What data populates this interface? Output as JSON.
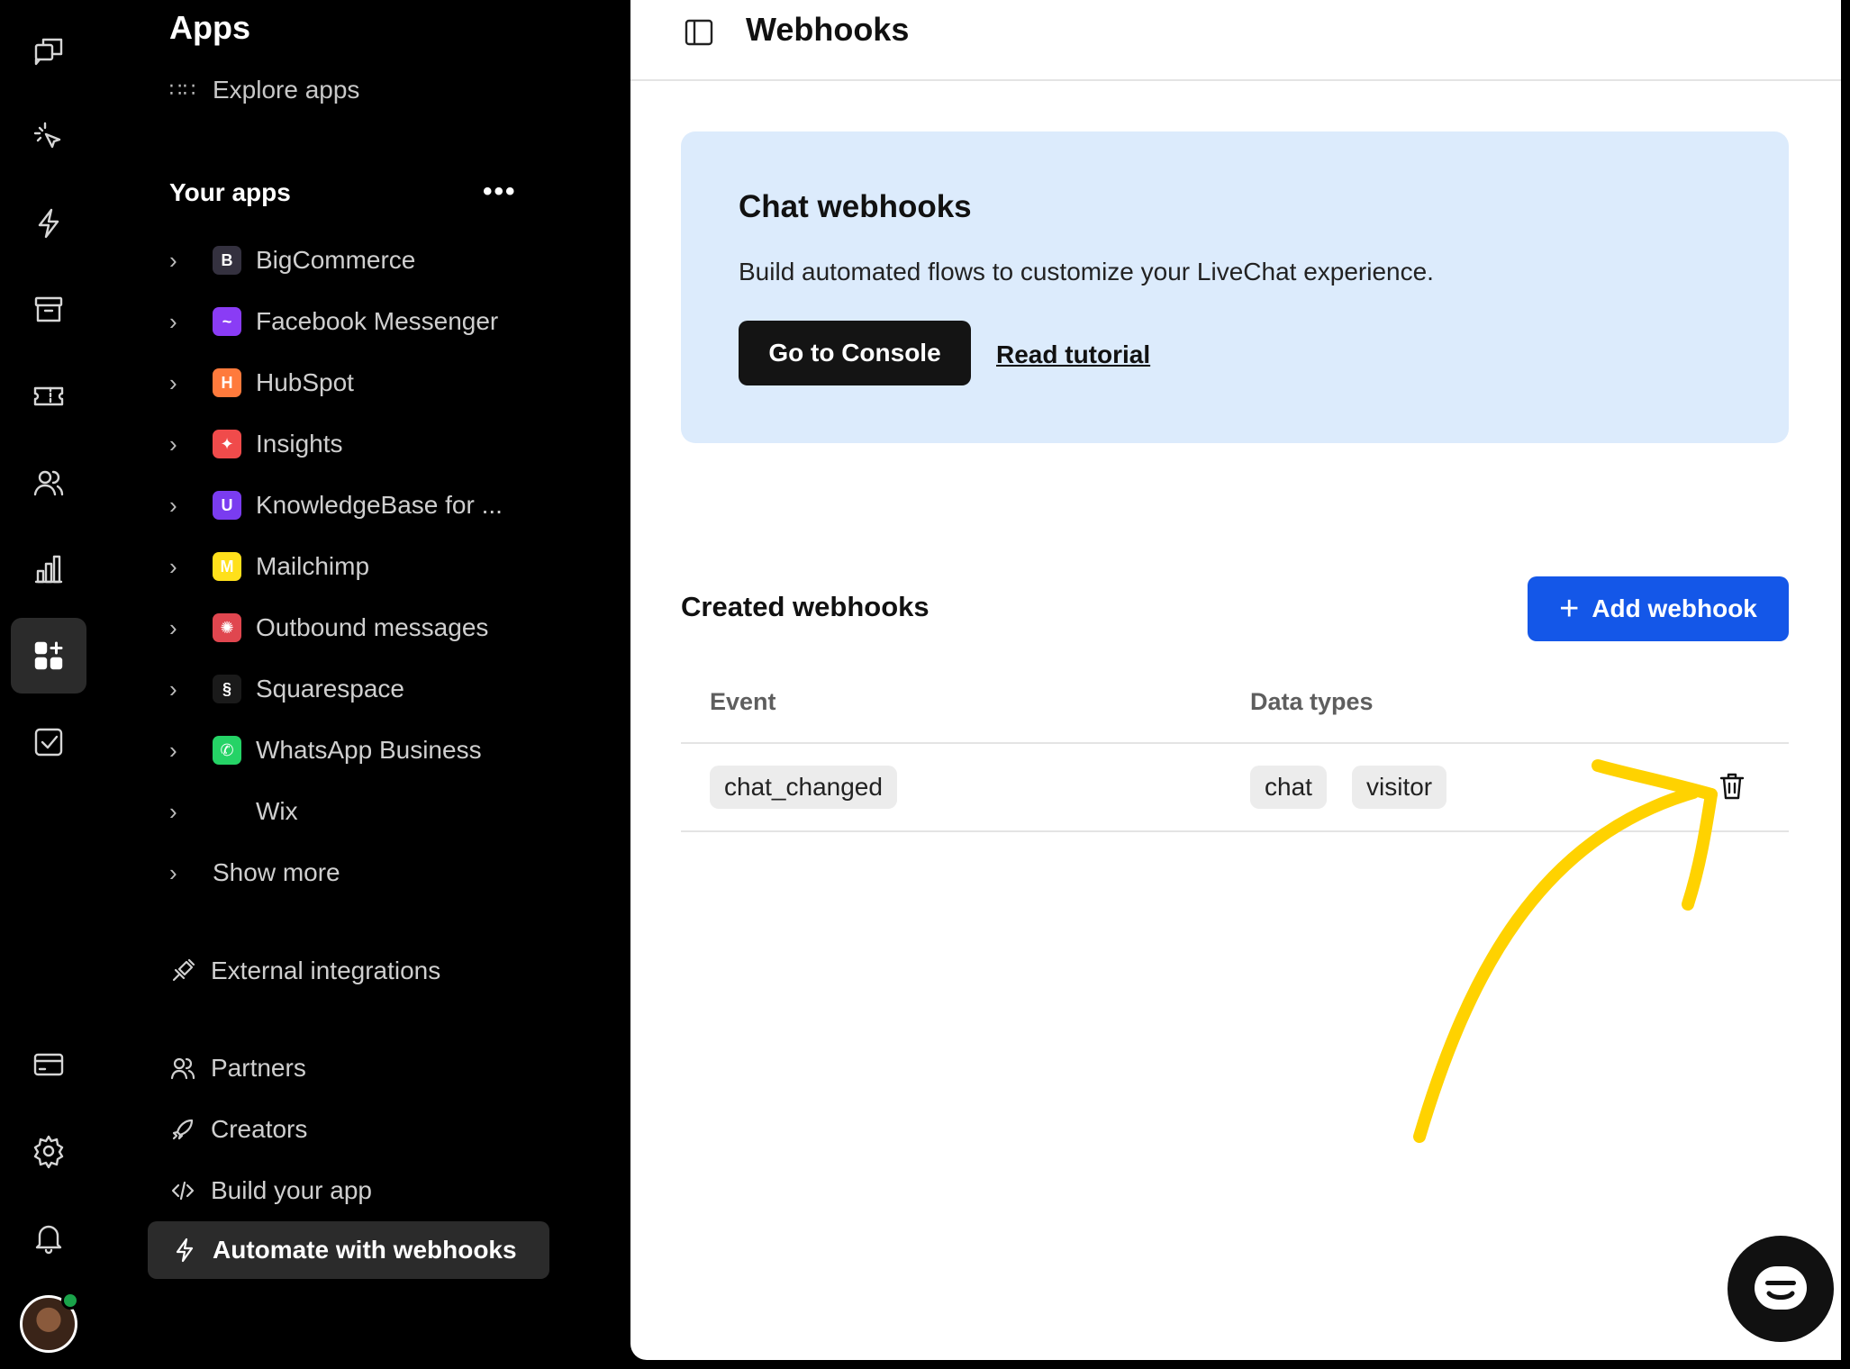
{
  "rail": {
    "items": [
      {
        "icon": "chats-icon"
      },
      {
        "icon": "engage-icon"
      },
      {
        "icon": "automate-icon"
      },
      {
        "icon": "archives-icon"
      },
      {
        "icon": "tickets-icon"
      },
      {
        "icon": "customers-icon"
      },
      {
        "icon": "reports-icon"
      },
      {
        "icon": "apps-icon",
        "active": true
      },
      {
        "icon": "goals-icon"
      },
      {
        "icon": "billing-icon"
      },
      {
        "icon": "settings-icon"
      },
      {
        "icon": "notifications-icon"
      }
    ]
  },
  "panel": {
    "title": "Apps",
    "explore_label": "Explore apps",
    "your_apps_label": "Your apps",
    "more_label": "•••",
    "apps": [
      {
        "label": "BigCommerce",
        "icon": "bigcommerce-icon",
        "color": "#34313f",
        "glyph": "B"
      },
      {
        "label": "Facebook Messenger",
        "icon": "messenger-icon",
        "color": "#8a3cf5",
        "glyph": "~"
      },
      {
        "label": "HubSpot",
        "icon": "hubspot-icon",
        "color": "#ff7a3c",
        "glyph": "H"
      },
      {
        "label": "Insights",
        "icon": "insights-icon",
        "color": "#f04b4b",
        "glyph": "✦"
      },
      {
        "label": "KnowledgeBase for ...",
        "icon": "knowledgebase-icon",
        "color": "#7a3cf0",
        "glyph": "U"
      },
      {
        "label": "Mailchimp",
        "icon": "mailchimp-icon",
        "color": "#ffe01b",
        "glyph": "M"
      },
      {
        "label": "Outbound messages",
        "icon": "outbound-icon",
        "color": "#e0464f",
        "glyph": "✺"
      },
      {
        "label": "Squarespace",
        "icon": "squarespace-icon",
        "color": "#1a1a1a",
        "glyph": "§"
      },
      {
        "label": "WhatsApp Business",
        "icon": "whatsapp-icon",
        "color": "#25d366",
        "glyph": "✆"
      },
      {
        "label": "Wix",
        "icon": "wix-icon",
        "color": "#000000",
        "glyph": ""
      }
    ],
    "show_more_label": "Show more",
    "external_label": "External integrations",
    "partners_label": "Partners",
    "creators_label": "Creators",
    "build_label": "Build your app",
    "webhooks_label": "Automate with webhooks"
  },
  "main": {
    "title": "Webhooks",
    "banner": {
      "title": "Chat webhooks",
      "description": "Build automated flows to customize your LiveChat experience.",
      "console_button": "Go to Console",
      "tutorial_link": "Read tutorial"
    },
    "section_title": "Created webhooks",
    "add_button": "Add webhook",
    "table": {
      "columns": [
        "Event",
        "Data types"
      ],
      "rows": [
        {
          "event": "chat_changed",
          "data_types": [
            "chat",
            "visitor"
          ]
        }
      ]
    }
  },
  "colors": {
    "accent": "#1457e8",
    "banner_bg": "#dcebfc",
    "annotation_arrow": "#ffd200"
  }
}
